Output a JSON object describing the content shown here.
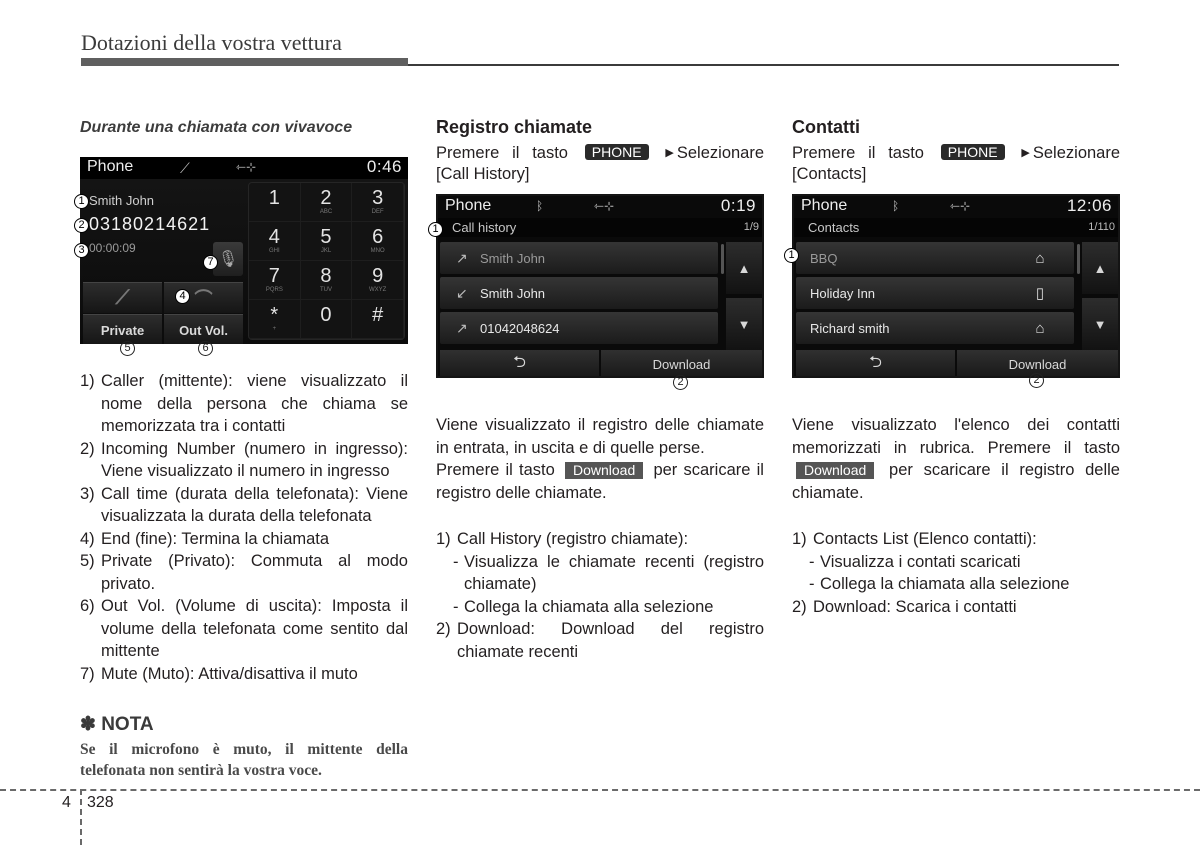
{
  "header": {
    "title": "Dotazioni della vostra vettura"
  },
  "col1": {
    "subtitle": "Durante una chiamata con vivavoce",
    "screen": {
      "app_title": "Phone",
      "status_icons": [
        "call-icon",
        "usb-icon"
      ],
      "clock": "0:46",
      "caller_name": "Smith John",
      "caller_number": "03180214621",
      "call_time": "00:00:09",
      "keypad": [
        {
          "digit": "1",
          "letters": ""
        },
        {
          "digit": "2",
          "letters": "ABC"
        },
        {
          "digit": "3",
          "letters": "DEF"
        },
        {
          "digit": "4",
          "letters": "GHI"
        },
        {
          "digit": "5",
          "letters": "JKL"
        },
        {
          "digit": "6",
          "letters": "MNO"
        },
        {
          "digit": "7",
          "letters": "PQRS"
        },
        {
          "digit": "8",
          "letters": "TUV"
        },
        {
          "digit": "9",
          "letters": "WXYZ"
        },
        {
          "digit": "*",
          "letters": "+"
        },
        {
          "digit": "0",
          "letters": ""
        },
        {
          "digit": "#",
          "letters": ""
        }
      ],
      "buttons": {
        "private": "Private",
        "out_vol": "Out Vol."
      },
      "callouts": [
        "1",
        "2",
        "3",
        "4",
        "5",
        "6",
        "7"
      ]
    },
    "items": [
      {
        "n": "1)",
        "text": "Caller (mittente): viene visualizzato il nome della persona che chiama se memorizzata tra i contatti"
      },
      {
        "n": "2)",
        "text": "Incoming Number (numero in ingresso): Viene visualizzato il numero in ingresso"
      },
      {
        "n": "3)",
        "text": "Call time (durata della telefonata): Viene visualizzata la durata della telefonata"
      },
      {
        "n": "4)",
        "text": "End (fine): Termina la chiamata"
      },
      {
        "n": "5)",
        "text": "Private (Privato): Commuta al modo privato."
      },
      {
        "n": "6)",
        "text": "Out Vol. (Volume di uscita): Imposta il volume della telefonata come sentito dal mittente"
      },
      {
        "n": "7)",
        "text": "Mute (Muto): Attiva/disattiva il muto"
      }
    ],
    "nota": {
      "title": "✽ NOTA",
      "body": "Se il microfono è muto, il mittente della telefonata non sentirà la vostra voce."
    }
  },
  "col2": {
    "title": "Registro chiamate",
    "intro_pre": "Premere il tasto",
    "key": "PHONE",
    "intro_post": "Selezionare [Call History]",
    "screen": {
      "app_title": "Phone",
      "clock": "0:19",
      "list_title": "Call history",
      "page": "1/9",
      "rows": [
        {
          "icon": "outgoing-call-icon",
          "label": "Smith John"
        },
        {
          "icon": "incoming-call-icon",
          "label": "Smith John"
        },
        {
          "icon": "outgoing-call-icon",
          "label": "01042048624"
        }
      ],
      "download": "Download"
    },
    "para1": "Viene visualizzato il registro delle chiamate in entrata, in uscita e di quelle perse.",
    "para2_pre": "Premere il tasto",
    "para2_badge": "Download",
    "para2_post": "per scaricare il registro delle chiamate.",
    "items": [
      {
        "n": "1)",
        "text": "Call History (registro chiamate):",
        "subs": [
          "Visualizza le chiamate recenti (registro chiamate)",
          "Collega la chiamata alla selezione"
        ]
      },
      {
        "n": "2)",
        "text": "Download: Download del registro chiamate recenti",
        "subs": []
      }
    ]
  },
  "col3": {
    "title": "Contatti",
    "intro_pre": "Premere il tasto",
    "key": "PHONE",
    "intro_post": "Selezionare [Contacts]",
    "screen": {
      "app_title": "Phone",
      "clock": "12:06",
      "list_title": "Contacts",
      "page": "1/110",
      "rows": [
        {
          "label": "BBQ",
          "type": "home-icon"
        },
        {
          "label": "Holiday Inn",
          "type": "mobile-icon"
        },
        {
          "label": "Richard smith",
          "type": "home-icon"
        }
      ],
      "download": "Download"
    },
    "para1_pre": "Viene visualizzato l'elenco dei contatti memorizzati in rubrica. Premere il tasto",
    "para1_badge": "Download",
    "para1_post": "per scaricare il registro delle chiamate.",
    "items": [
      {
        "n": "1)",
        "text": "Contacts List (Elenco contatti):",
        "subs": [
          "Visualizza i contati scaricati",
          "Collega la chiamata alla selezione"
        ]
      },
      {
        "n": "2)",
        "text": "Download: Scarica i contatti",
        "subs": []
      }
    ]
  },
  "footer": {
    "chapter": "4",
    "page": "328"
  }
}
